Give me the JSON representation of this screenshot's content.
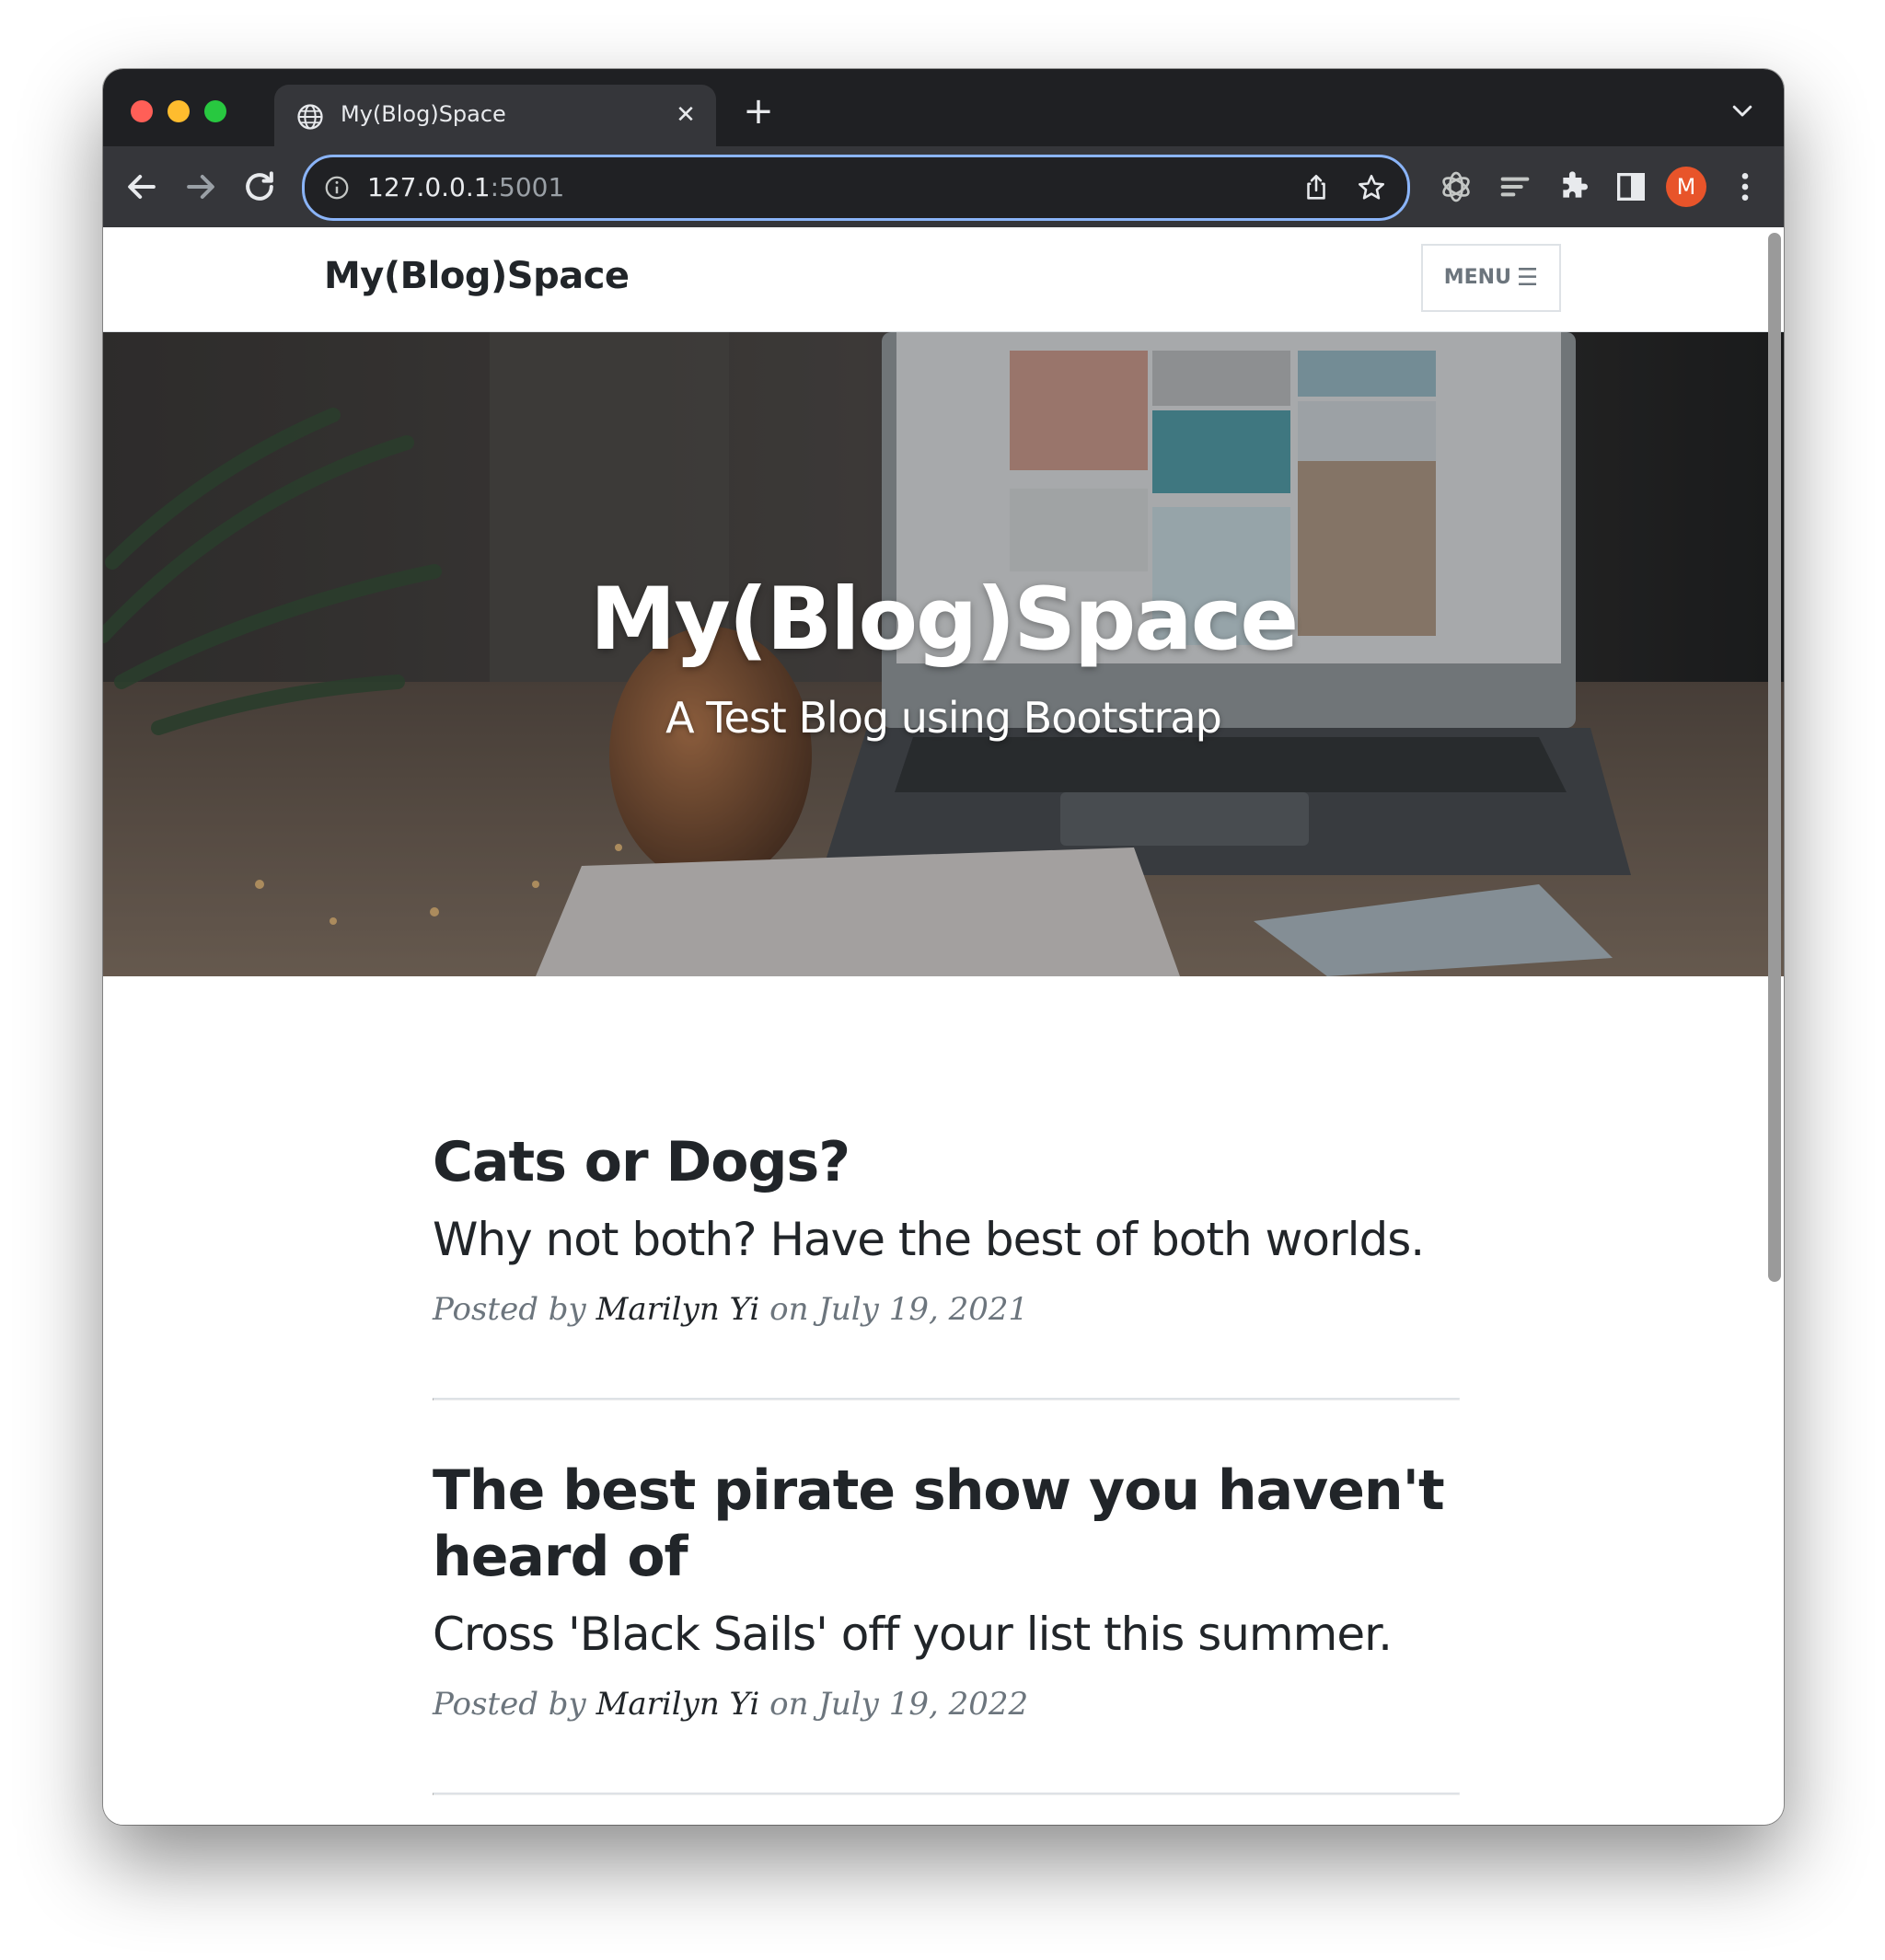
{
  "browser": {
    "tab_title": "My(Blog)Space",
    "url_host": "127.0.0.1",
    "url_port": ":5001",
    "profile_initial": "M",
    "icons": {
      "favicon": "globe-icon",
      "close": "close-icon",
      "new_tab": "plus-icon",
      "tab_search": "chevron-down-icon",
      "back": "back-arrow-icon",
      "forward": "forward-arrow-icon",
      "reload": "reload-icon",
      "info": "info-icon",
      "share": "share-icon",
      "bookmark": "star-icon",
      "extension_1": "openai-icon",
      "extension_2": "reading-list-icon",
      "extensions": "puzzle-icon",
      "side_panel": "side-panel-icon",
      "menu": "kebab-menu-icon"
    },
    "colors": {
      "tabstrip": "#1f2023",
      "toolbar": "#35363a",
      "omnibox_border": "#8ab4f8",
      "avatar": "#e8542a",
      "close_dot": "#ff5f57",
      "minimize_dot": "#febc2e",
      "zoom_dot": "#28c840"
    }
  },
  "site": {
    "brand": "My(Blog)Space",
    "menu_label": "MENU",
    "menu_icon": "hamburger-icon",
    "masthead": {
      "heading": "My(Blog)Space",
      "subheading": "A Test Blog using Bootstrap"
    },
    "posts": [
      {
        "title": "Cats or Dogs?",
        "subtitle": "Why not both? Have the best of both worlds.",
        "posted_by": "Posted by",
        "author": "Marilyn Yi",
        "on": "on July 19, 2021"
      },
      {
        "title": "The best pirate show you haven't heard of",
        "subtitle": "Cross 'Black Sails' off your list this summer.",
        "posted_by": "Posted by",
        "author": "Marilyn Yi",
        "on": "on July 19, 2022"
      }
    ]
  }
}
